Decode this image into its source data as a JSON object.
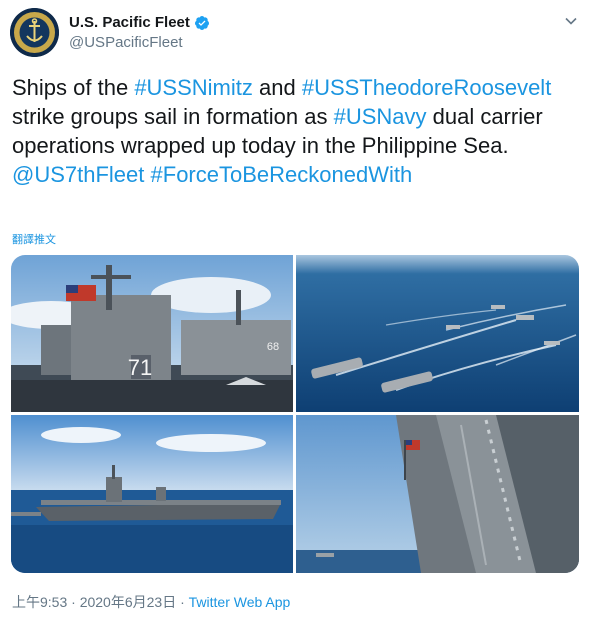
{
  "account": {
    "display_name": "U.S. Pacific Fleet",
    "handle": "@USPacificFleet"
  },
  "tweet": {
    "segments": [
      {
        "text": "Ships of the ",
        "tag": false
      },
      {
        "text": "#USSNimitz",
        "tag": true
      },
      {
        "text": " and ",
        "tag": false
      },
      {
        "text": "#USSTheodoreRoosevelt",
        "tag": true
      },
      {
        "text": " strike groups sail in formation as ",
        "tag": false
      },
      {
        "text": "#USNavy",
        "tag": true
      },
      {
        "text": " dual carrier operations wrapped up today in the Philippine Sea. ",
        "tag": false
      },
      {
        "text": "@US7thFleet",
        "tag": true
      },
      {
        "text": " ",
        "tag": false
      },
      {
        "text": "#ForceToBeReckonedWith",
        "tag": true
      }
    ],
    "translate_label": "翻譯推文"
  },
  "photos": {
    "hull_number": "71",
    "second_hull_number": "68"
  },
  "footer": {
    "timestamp": "上午9:53 · 2020年6月23日 · ",
    "source": "Twitter Web App"
  },
  "icons": {
    "verified": "verified-badge-icon",
    "caret": "chevron-down-icon"
  },
  "colors": {
    "link": "#1b95e0",
    "muted": "#657786",
    "text": "#14171a"
  }
}
